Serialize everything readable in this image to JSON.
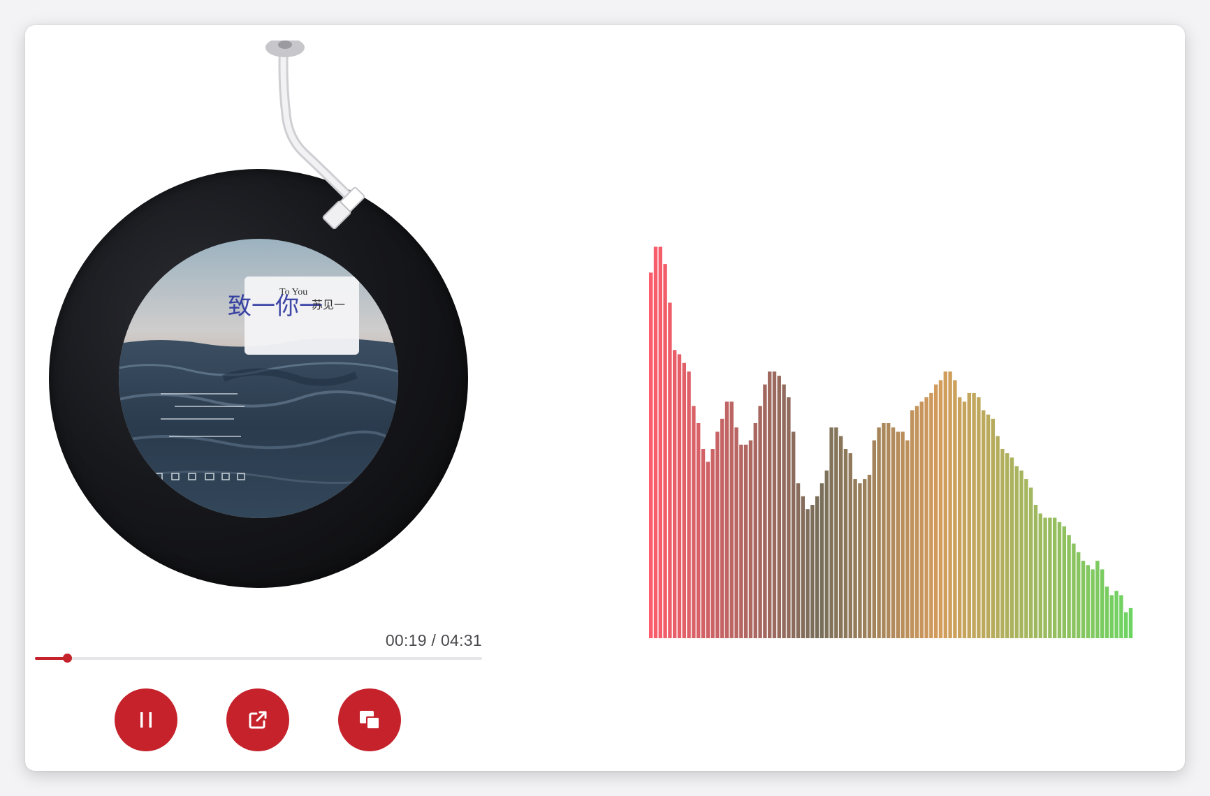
{
  "player": {
    "album_cover": {
      "label_en": "To You",
      "label_script_large": "致一你一",
      "label_script_small": "苏见一"
    },
    "time": {
      "current": "00:19",
      "total": "04:31",
      "display": "00:19 / 04:31"
    },
    "progress_fraction": 0.072,
    "controls": [
      {
        "name": "pause-button",
        "icon": "pause-icon"
      },
      {
        "name": "open-external-button",
        "icon": "external-link-icon"
      },
      {
        "name": "picture-in-picture-button",
        "icon": "pip-icon"
      }
    ],
    "colors": {
      "accent": "#c5222b",
      "spectrum_start": "#fc5c6c",
      "spectrum_mid": "#d49c5c",
      "spectrum_end": "#6cd461"
    }
  },
  "visualizer": {
    "type": "frequency-bars",
    "max": 1.0,
    "values": [
      0.85,
      0.91,
      0.91,
      0.87,
      0.78,
      0.67,
      0.66,
      0.64,
      0.62,
      0.54,
      0.5,
      0.44,
      0.41,
      0.44,
      0.48,
      0.51,
      0.55,
      0.55,
      0.49,
      0.45,
      0.45,
      0.46,
      0.5,
      0.54,
      0.59,
      0.62,
      0.62,
      0.61,
      0.59,
      0.56,
      0.48,
      0.36,
      0.33,
      0.3,
      0.31,
      0.33,
      0.36,
      0.39,
      0.49,
      0.49,
      0.47,
      0.44,
      0.43,
      0.37,
      0.36,
      0.37,
      0.38,
      0.46,
      0.49,
      0.5,
      0.5,
      0.49,
      0.48,
      0.48,
      0.46,
      0.53,
      0.54,
      0.55,
      0.56,
      0.57,
      0.59,
      0.6,
      0.62,
      0.62,
      0.6,
      0.56,
      0.55,
      0.57,
      0.57,
      0.56,
      0.53,
      0.52,
      0.51,
      0.47,
      0.44,
      0.43,
      0.42,
      0.4,
      0.39,
      0.37,
      0.35,
      0.31,
      0.29,
      0.28,
      0.28,
      0.28,
      0.27,
      0.26,
      0.24,
      0.22,
      0.2,
      0.18,
      0.17,
      0.16,
      0.18,
      0.16,
      0.12,
      0.1,
      0.11,
      0.1,
      0.06,
      0.07
    ]
  }
}
